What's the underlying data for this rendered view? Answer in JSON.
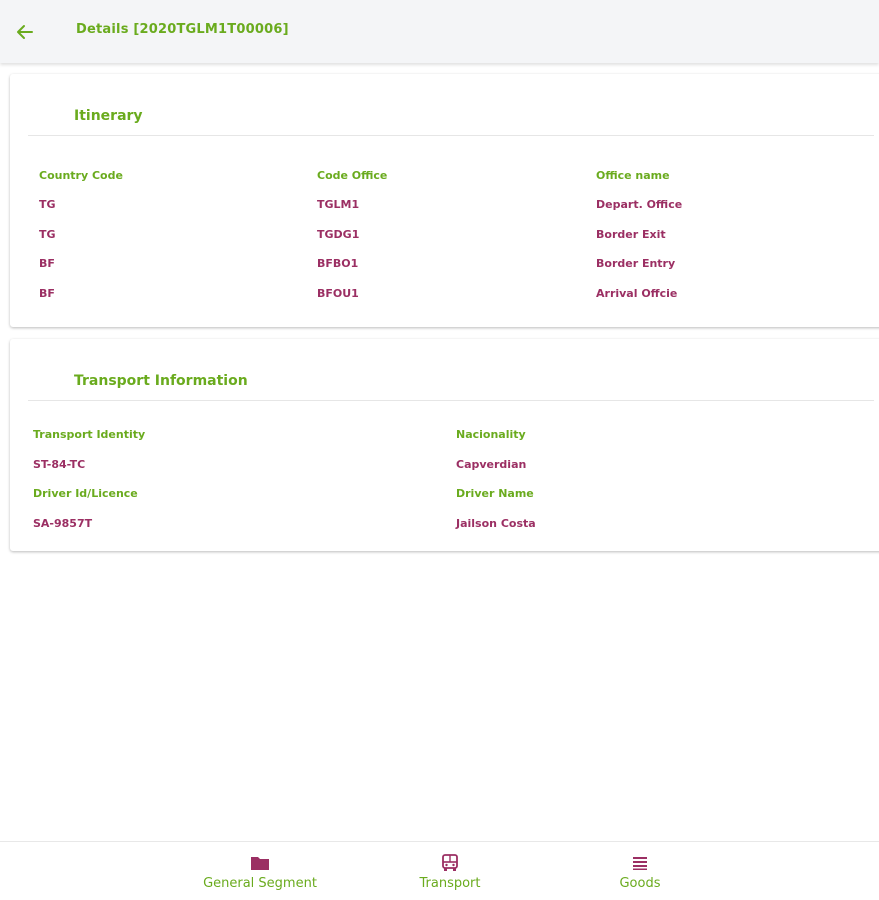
{
  "header": {
    "title": "Details [2020TGLM1T00006]",
    "back_icon": "arrow-left-icon"
  },
  "itinerary": {
    "title": "Itinerary",
    "columns": [
      "Country Code",
      "Code Office",
      "Office name"
    ],
    "rows": [
      [
        "TG",
        "TGLM1",
        "Depart. Office"
      ],
      [
        "TG",
        "TGDG1",
        "Border Exit"
      ],
      [
        "BF",
        "BFBO1",
        "Border Entry"
      ],
      [
        "BF",
        "BFOU1",
        "Arrival Offcie"
      ]
    ]
  },
  "transport": {
    "title": "Transport Information",
    "transport_identity_label": "Transport Identity",
    "transport_identity_value": "ST-84-TC",
    "nationality_label": "Nacionality",
    "nationality_value": "Capverdian",
    "driver_id_label": "Driver Id/Licence",
    "driver_id_value": "SA-9857T",
    "driver_name_label": "Driver Name",
    "driver_name_value": "Jailson Costa"
  },
  "bottom_nav": {
    "items": [
      {
        "label": "General Segment",
        "icon": "folder-icon"
      },
      {
        "label": "Transport",
        "icon": "bus-icon"
      },
      {
        "label": "Goods",
        "icon": "list-icon"
      }
    ]
  },
  "colors": {
    "accent_green": "#6aab1e",
    "value_maroon": "#9b2f63"
  }
}
